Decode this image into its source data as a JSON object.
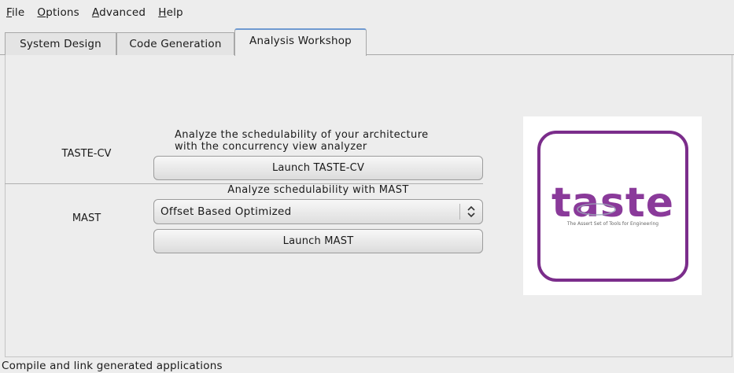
{
  "menu": {
    "file": {
      "mnemonic": "F",
      "rest": "ile"
    },
    "options": {
      "mnemonic": "O",
      "rest": "ptions"
    },
    "advanced": {
      "mnemonic": "A",
      "rest": "dvanced"
    },
    "help": {
      "mnemonic": "H",
      "rest": "elp"
    }
  },
  "tabs": [
    {
      "label": "System Design",
      "active": false
    },
    {
      "label": "Code Generation",
      "active": false
    },
    {
      "label": "Analysis Workshop",
      "active": true
    }
  ],
  "taste_cv": {
    "label": "TASTE-CV",
    "description_line1": "Analyze the schedulability of your architecture",
    "description_line2": "with the concurrency view analyzer",
    "button": "Launch TASTE-CV"
  },
  "mast": {
    "label": "MAST",
    "description": "Analyze schedulability with MAST",
    "combo_value": "Offset Based Optimized",
    "button": "Launch MAST"
  },
  "logo": {
    "word": "taste",
    "tagline": "The Assert Set of Tools for Engineering",
    "frame_color": "#7b2d8b",
    "text_color": "#8a3a9a"
  },
  "status": {
    "text": "Compile and link generated applications"
  },
  "colors": {
    "window_bg": "#ededed",
    "active_tab_accent": "#6f9ad0"
  }
}
